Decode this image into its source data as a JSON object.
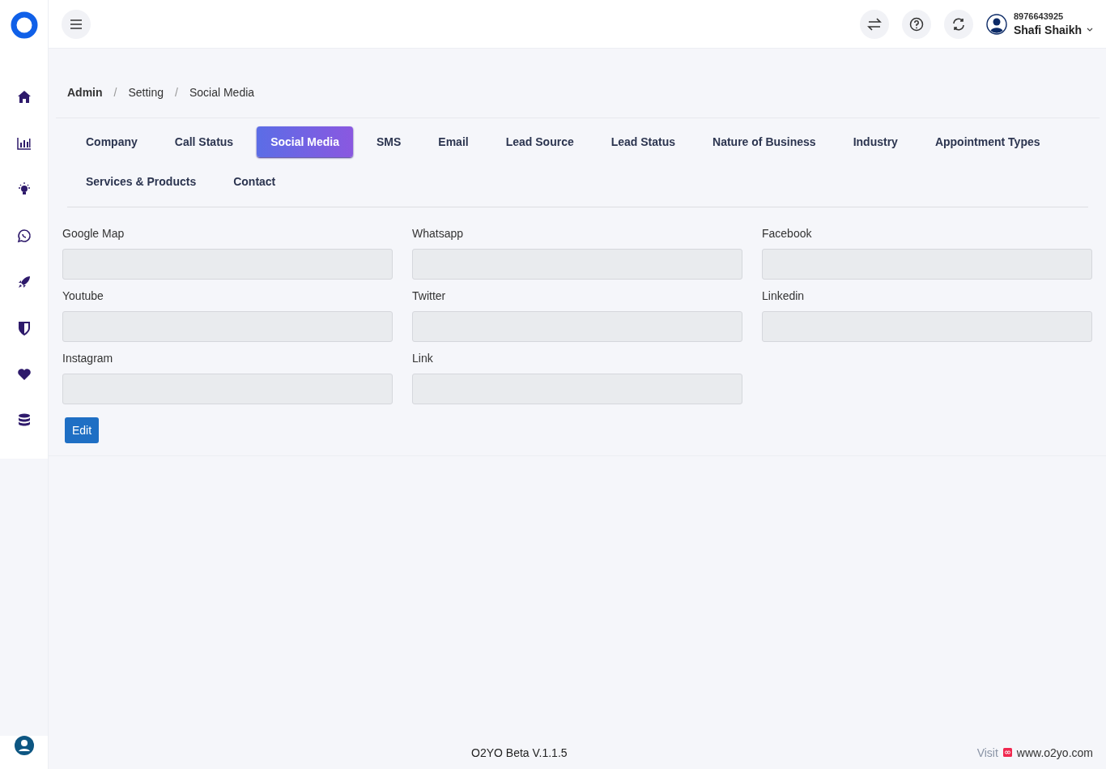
{
  "topbar": {
    "phone": "8976643925",
    "user_name": "Shafi Shaikh"
  },
  "breadcrumb": [
    "Admin",
    "Setting",
    "Social Media"
  ],
  "breadcrumb_separator": "/",
  "tabs": [
    {
      "label": "Company",
      "selected": false
    },
    {
      "label": "Call Status",
      "selected": false
    },
    {
      "label": "Social Media",
      "selected": true
    },
    {
      "label": "SMS",
      "selected": false
    },
    {
      "label": "Email",
      "selected": false
    },
    {
      "label": "Lead Source",
      "selected": false
    },
    {
      "label": "Lead Status",
      "selected": false
    },
    {
      "label": "Nature of Business",
      "selected": false
    },
    {
      "label": "Industry",
      "selected": false
    },
    {
      "label": "Appointment Types",
      "selected": false
    },
    {
      "label": "Services & Products",
      "selected": false
    },
    {
      "label": "Contact",
      "selected": false
    }
  ],
  "fields": [
    {
      "label": "Google Map"
    },
    {
      "label": "Whatsapp"
    },
    {
      "label": "Facebook"
    },
    {
      "label": "Youtube"
    },
    {
      "label": "Twitter"
    },
    {
      "label": "Linkedin"
    },
    {
      "label": "Instagram"
    },
    {
      "label": "Link"
    }
  ],
  "edit_button": "Edit",
  "footer": {
    "version": "O2YO Beta V.1.1.5",
    "visit_label": "Visit",
    "website": "www.o2yo.com"
  }
}
